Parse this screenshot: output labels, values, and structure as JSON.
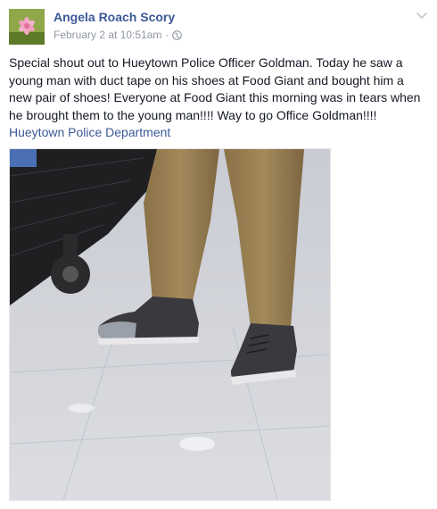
{
  "post": {
    "author": "Angela Roach Scory",
    "date": "February 2 at 10:51am",
    "separator": "·",
    "body": "Special shout out to Hueytown Police Officer Goldman. Today he saw a young man with duct tape on his shoes at Food Giant and bought him a new pair of shoes! Everyone at Food Giant this morning was in tears when he brought them to the young man!!!! Way to go Office Goldman!!!!",
    "tagged_page": "Hueytown Police Department"
  },
  "icons": {
    "privacy": "globe-icon",
    "options": "chevron-down-icon"
  },
  "colors": {
    "link": "#3b5998",
    "meta": "#9197a3",
    "text": "#141823"
  }
}
